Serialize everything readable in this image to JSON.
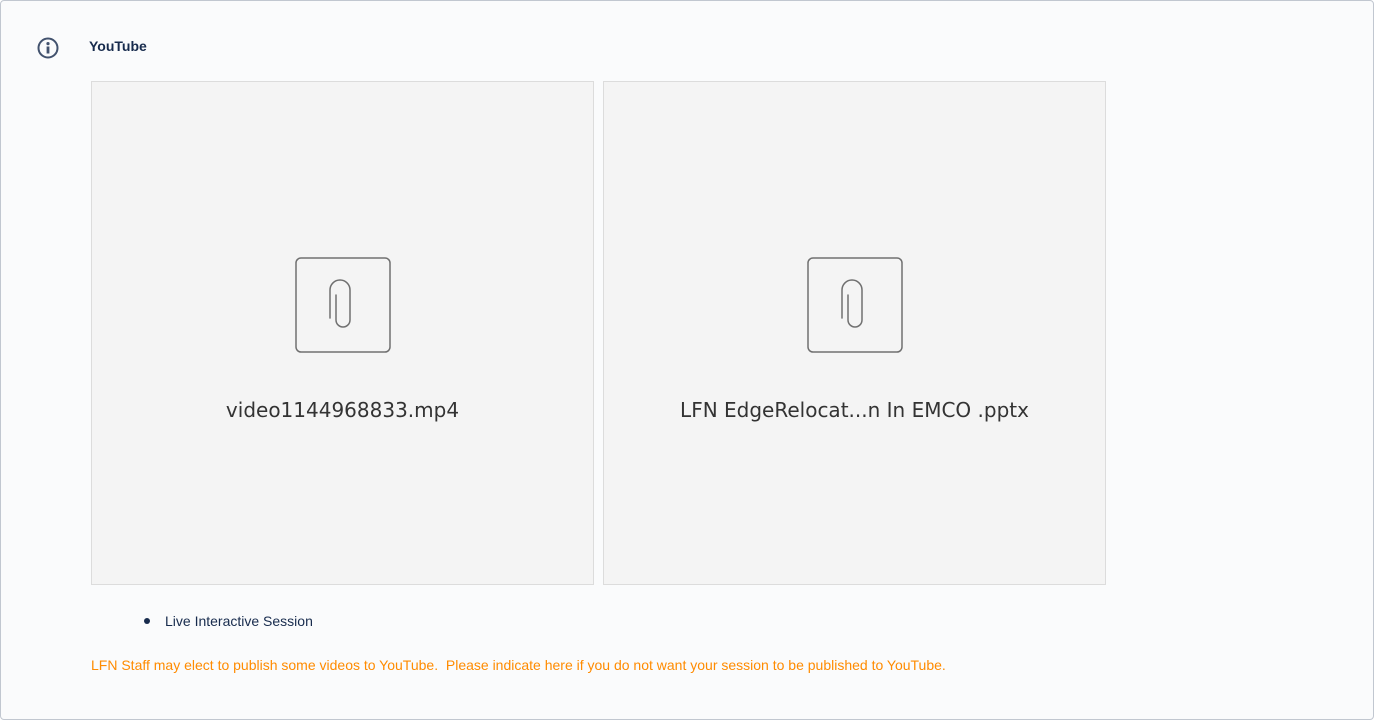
{
  "panel": {
    "icon": "info-icon",
    "title": "YouTube"
  },
  "attachments": [
    {
      "icon": "paperclip-icon",
      "filename": "video1144968833.mp4"
    },
    {
      "icon": "paperclip-icon",
      "filename": "LFN EdgeRelocat...n In EMCO .pptx"
    }
  ],
  "list": {
    "items": [
      "Live Interactive Session"
    ]
  },
  "notice": {
    "text": "LFN Staff may elect to publish some videos to YouTube.  Please indicate here if you do not want your session to be published to YouTube."
  },
  "colors": {
    "notice": "#ff8b00",
    "panel_border": "#c1c7d0",
    "tile_background": "#f4f4f4"
  }
}
